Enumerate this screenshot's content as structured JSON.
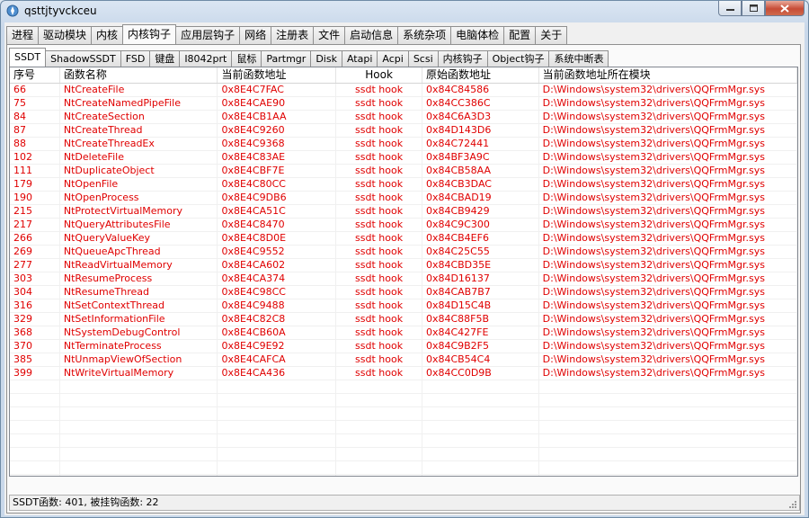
{
  "window": {
    "title": "qsttjtyvckceu"
  },
  "main_tabs": [
    "进程",
    "驱动模块",
    "内核",
    "内核钩子",
    "应用层钩子",
    "网络",
    "注册表",
    "文件",
    "启动信息",
    "系统杂项",
    "电脑体检",
    "配置",
    "关于"
  ],
  "main_active": 3,
  "sub_tabs": [
    "SSDT",
    "ShadowSSDT",
    "FSD",
    "键盘",
    "I8042prt",
    "鼠标",
    "Partmgr",
    "Disk",
    "Atapi",
    "Acpi",
    "Scsi",
    "内核钩子",
    "Object钩子",
    "系统中断表"
  ],
  "sub_active": 0,
  "columns": [
    "序号",
    "函数名称",
    "当前函数地址",
    "Hook",
    "原始函数地址",
    "当前函数地址所在模块"
  ],
  "rows": [
    [
      "66",
      "NtCreateFile",
      "0x8E4C7FAC",
      "ssdt hook",
      "0x84C84586",
      "D:\\Windows\\system32\\drivers\\QQFrmMgr.sys"
    ],
    [
      "75",
      "NtCreateNamedPipeFile",
      "0x8E4CAE90",
      "ssdt hook",
      "0x84CC386C",
      "D:\\Windows\\system32\\drivers\\QQFrmMgr.sys"
    ],
    [
      "84",
      "NtCreateSection",
      "0x8E4CB1AA",
      "ssdt hook",
      "0x84C6A3D3",
      "D:\\Windows\\system32\\drivers\\QQFrmMgr.sys"
    ],
    [
      "87",
      "NtCreateThread",
      "0x8E4C9260",
      "ssdt hook",
      "0x84D143D6",
      "D:\\Windows\\system32\\drivers\\QQFrmMgr.sys"
    ],
    [
      "88",
      "NtCreateThreadEx",
      "0x8E4C9368",
      "ssdt hook",
      "0x84C72441",
      "D:\\Windows\\system32\\drivers\\QQFrmMgr.sys"
    ],
    [
      "102",
      "NtDeleteFile",
      "0x8E4C83AE",
      "ssdt hook",
      "0x84BF3A9C",
      "D:\\Windows\\system32\\drivers\\QQFrmMgr.sys"
    ],
    [
      "111",
      "NtDuplicateObject",
      "0x8E4CBF7E",
      "ssdt hook",
      "0x84CB58AA",
      "D:\\Windows\\system32\\drivers\\QQFrmMgr.sys"
    ],
    [
      "179",
      "NtOpenFile",
      "0x8E4C80CC",
      "ssdt hook",
      "0x84CB3DAC",
      "D:\\Windows\\system32\\drivers\\QQFrmMgr.sys"
    ],
    [
      "190",
      "NtOpenProcess",
      "0x8E4C9DB6",
      "ssdt hook",
      "0x84CBAD19",
      "D:\\Windows\\system32\\drivers\\QQFrmMgr.sys"
    ],
    [
      "215",
      "NtProtectVirtualMemory",
      "0x8E4CA51C",
      "ssdt hook",
      "0x84CB9429",
      "D:\\Windows\\system32\\drivers\\QQFrmMgr.sys"
    ],
    [
      "217",
      "NtQueryAttributesFile",
      "0x8E4C8470",
      "ssdt hook",
      "0x84C9C300",
      "D:\\Windows\\system32\\drivers\\QQFrmMgr.sys"
    ],
    [
      "266",
      "NtQueryValueKey",
      "0x8E4C8D0E",
      "ssdt hook",
      "0x84CB4EF6",
      "D:\\Windows\\system32\\drivers\\QQFrmMgr.sys"
    ],
    [
      "269",
      "NtQueueApcThread",
      "0x8E4C9552",
      "ssdt hook",
      "0x84C25C55",
      "D:\\Windows\\system32\\drivers\\QQFrmMgr.sys"
    ],
    [
      "277",
      "NtReadVirtualMemory",
      "0x8E4CA602",
      "ssdt hook",
      "0x84CBD35E",
      "D:\\Windows\\system32\\drivers\\QQFrmMgr.sys"
    ],
    [
      "303",
      "NtResumeProcess",
      "0x8E4CA374",
      "ssdt hook",
      "0x84D16137",
      "D:\\Windows\\system32\\drivers\\QQFrmMgr.sys"
    ],
    [
      "304",
      "NtResumeThread",
      "0x8E4C98CC",
      "ssdt hook",
      "0x84CAB7B7",
      "D:\\Windows\\system32\\drivers\\QQFrmMgr.sys"
    ],
    [
      "316",
      "NtSetContextThread",
      "0x8E4C9488",
      "ssdt hook",
      "0x84D15C4B",
      "D:\\Windows\\system32\\drivers\\QQFrmMgr.sys"
    ],
    [
      "329",
      "NtSetInformationFile",
      "0x8E4C82C8",
      "ssdt hook",
      "0x84C88F5B",
      "D:\\Windows\\system32\\drivers\\QQFrmMgr.sys"
    ],
    [
      "368",
      "NtSystemDebugControl",
      "0x8E4CB60A",
      "ssdt hook",
      "0x84C427FE",
      "D:\\Windows\\system32\\drivers\\QQFrmMgr.sys"
    ],
    [
      "370",
      "NtTerminateProcess",
      "0x8E4C9E92",
      "ssdt hook",
      "0x84C9B2F5",
      "D:\\Windows\\system32\\drivers\\QQFrmMgr.sys"
    ],
    [
      "385",
      "NtUnmapViewOfSection",
      "0x8E4CAFCA",
      "ssdt hook",
      "0x84CB54C4",
      "D:\\Windows\\system32\\drivers\\QQFrmMgr.sys"
    ],
    [
      "399",
      "NtWriteVirtualMemory",
      "0x8E4CA436",
      "ssdt hook",
      "0x84CC0D9B",
      "D:\\Windows\\system32\\drivers\\QQFrmMgr.sys"
    ]
  ],
  "status": {
    "text": "SSDT函数: 401, 被挂钩函数: 22"
  },
  "colors": {
    "hooked_row_text": "#e00000"
  }
}
